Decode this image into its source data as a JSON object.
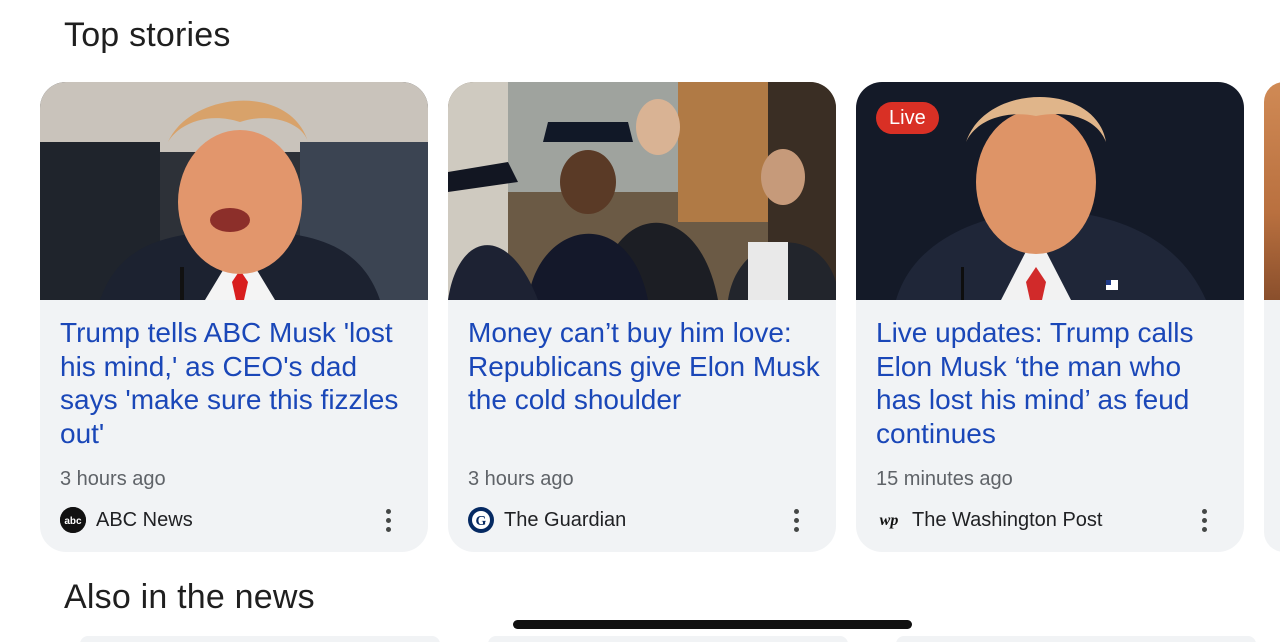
{
  "sections": {
    "top_stories_title": "Top stories",
    "also_title": "Also in the news"
  },
  "cards": [
    {
      "headline": "Trump tells ABC Musk 'lost his mind,' as CEO's dad says 'make sure this fizzles out'",
      "time": "3 hours ago",
      "source": "ABC News",
      "source_logo_text": "abc",
      "source_logo_color": "#111111"
    },
    {
      "headline": "Money can’t buy him love: Republicans give Elon Musk the cold shoulder",
      "time": "3 hours ago",
      "source": "The Guardian",
      "source_logo_text": "G",
      "source_logo_color": "#052962"
    },
    {
      "headline": "Live updates: Trump calls Elon Musk ‘the man who has lost his mind’ as feud continues",
      "time": "15 minutes ago",
      "source": "The Washington Post",
      "source_logo_text": "wp",
      "live_badge": "Live",
      "live_color": "#d93025"
    }
  ],
  "icons": {
    "more": "more-vert-icon"
  },
  "colors": {
    "headline": "#1a47b8",
    "card_bg": "#f1f3f5"
  }
}
